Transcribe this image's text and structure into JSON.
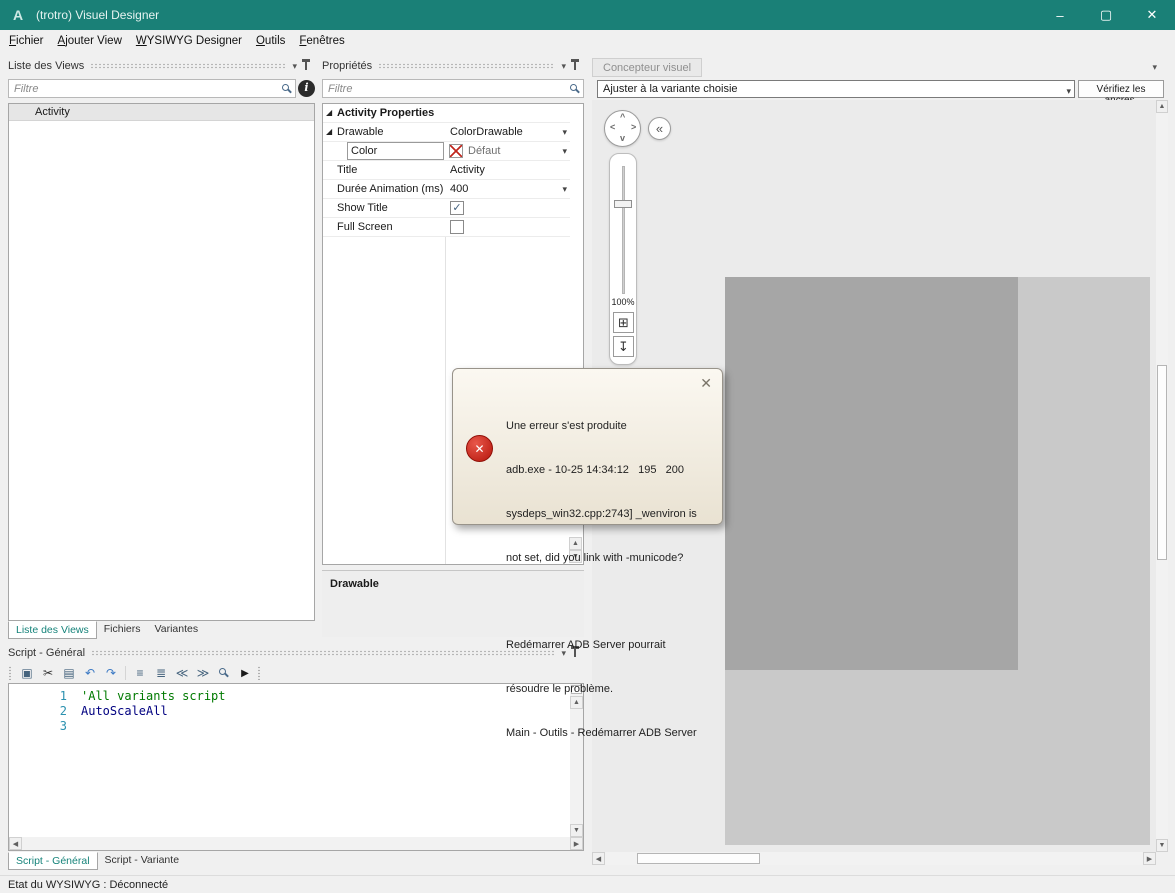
{
  "window": {
    "title": "(trotro) Visuel Designer",
    "logo": "A"
  },
  "icons": {
    "minimize": "–",
    "maximize": "▢",
    "close": "✕",
    "dropdown": "▾",
    "collapse": "«",
    "expander": "◢",
    "check": "✓",
    "up": "▲",
    "down": "▼",
    "left": "◀",
    "right": "▶",
    "dpad_up": "^",
    "dpad_down": "v",
    "dpad_left": "<",
    "dpad_right": ">",
    "grid": "⊞",
    "export": "↧",
    "info": "i",
    "tb_window": "▣",
    "tb_cut": "✂",
    "tb_copy": "▤",
    "tb_undo": "↶",
    "tb_redo": "↷",
    "tb_list1": "≡",
    "tb_list2": "≣",
    "tb_outdent": "≪",
    "tb_indent": "≫",
    "tb_run": "▶"
  },
  "menu": {
    "items": [
      "Fichier",
      "Ajouter View",
      "WYSIWYG Designer",
      "Outils",
      "Fenêtres"
    ]
  },
  "views_panel": {
    "title": "Liste des Views",
    "filter_placeholder": "Filtre",
    "rows": {
      "activity": "Activity"
    },
    "tabs": {
      "views": "Liste des Views",
      "files": "Fichiers",
      "variants": "Variantes"
    }
  },
  "properties_panel": {
    "title": "Propriétés",
    "filter_placeholder": "Filtre",
    "group_header": "Activity Properties",
    "rows": {
      "drawable": {
        "label": "Drawable",
        "value": "ColorDrawable"
      },
      "color": {
        "label": "Color",
        "value": "Défaut"
      },
      "title": {
        "label": "Title",
        "value": "Activity"
      },
      "duration": {
        "label": "Durée Animation (ms)",
        "value": "400"
      },
      "show_title": {
        "label": "Show Title",
        "checked": true
      },
      "full_screen": {
        "label": "Full Screen",
        "checked": false
      }
    },
    "description_title": "Drawable"
  },
  "designer": {
    "tab": "Concepteur visuel",
    "variant_selector": "Ajuster à la variante choisie",
    "anchors_button": "Vérifiez les ancres.",
    "zoom": "100%"
  },
  "error_popup": {
    "lines": [
      "Une erreur s'est produite",
      "adb.exe - 10-25 14:34:12   195   200",
      "sysdeps_win32.cpp:2743] _wenviron is",
      "not set, did you link with -municode?",
      "",
      "Redémarrer ADB Server pourrait",
      "résoudre le problème.",
      "Main - Outils - Redémarrer ADB Server"
    ]
  },
  "script_panel": {
    "title": "Script - Général",
    "lines": [
      {
        "num": "1",
        "text": "'All variants script"
      },
      {
        "num": "2",
        "text": "AutoScaleAll"
      },
      {
        "num": "3",
        "text": ""
      }
    ],
    "tabs": {
      "general": "Script - Général",
      "variant": "Script - Variante"
    }
  },
  "status_bar": {
    "text": "Etat du WYSIWYG : Déconnecté"
  },
  "colors": {
    "titlebar": "#1a8077",
    "accent": "#16837a",
    "error_red": "#b5150b",
    "comment_green": "#007a00",
    "line_number_teal": "#2b91af"
  }
}
